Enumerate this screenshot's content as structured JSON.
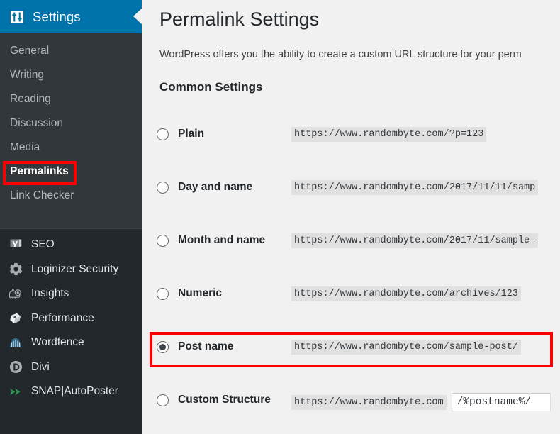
{
  "sidebar": {
    "menu_header": {
      "label": "Settings",
      "icon": "settings-sliders-icon",
      "bg_color": "#0073aa"
    },
    "submenu": [
      {
        "label": "General",
        "current": false
      },
      {
        "label": "Writing",
        "current": false
      },
      {
        "label": "Reading",
        "current": false
      },
      {
        "label": "Discussion",
        "current": false
      },
      {
        "label": "Media",
        "current": false
      },
      {
        "label": "Permalinks",
        "current": true,
        "highlighted": true
      },
      {
        "label": "Link Checker",
        "current": false
      }
    ],
    "plugins": [
      {
        "label": "SEO",
        "icon": "yoast-seo-icon"
      },
      {
        "label": "Loginizer Security",
        "icon": "gear-icon"
      },
      {
        "label": "Insights",
        "icon": "insights-analytics-icon"
      },
      {
        "label": "Performance",
        "icon": "performance-cube-icon"
      },
      {
        "label": "Wordfence",
        "icon": "wordfence-icon"
      },
      {
        "label": "Divi",
        "icon": "divi-circle-d-icon"
      },
      {
        "label": "SNAP|AutoPoster",
        "icon": "double-chevron-icon"
      }
    ]
  },
  "main": {
    "page_title": "Permalink Settings",
    "intro": "WordPress offers you the ability to create a custom URL structure for your perm",
    "section_title": "Common Settings",
    "options": [
      {
        "label": "Plain",
        "example": "https://www.randombyte.com/?p=123",
        "selected": false,
        "highlighted": false
      },
      {
        "label": "Day and name",
        "example": "https://www.randombyte.com/2017/11/11/samp",
        "selected": false,
        "highlighted": false
      },
      {
        "label": "Month and name",
        "example": "https://www.randombyte.com/2017/11/sample-",
        "selected": false,
        "highlighted": false
      },
      {
        "label": "Numeric",
        "example": "https://www.randombyte.com/archives/123",
        "selected": false,
        "highlighted": false
      },
      {
        "label": "Post name",
        "example": "https://www.randombyte.com/sample-post/",
        "selected": true,
        "highlighted": true
      },
      {
        "label": "Custom Structure",
        "example": "https://www.randombyte.com",
        "selected": false,
        "highlighted": false,
        "input_value": "/%postname%/"
      }
    ]
  },
  "annotations": {
    "highlight_color": "#fe0000",
    "items": [
      {
        "target": "sidebar-item-permalinks"
      },
      {
        "target": "option-row-post-name"
      }
    ]
  }
}
